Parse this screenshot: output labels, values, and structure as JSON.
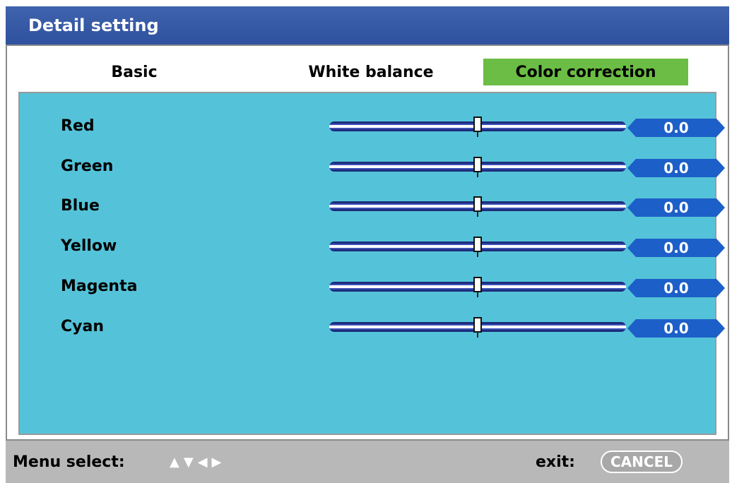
{
  "window": {
    "title": "Detail setting"
  },
  "tabs": [
    {
      "label": "Basic",
      "active": false
    },
    {
      "label": "White balance",
      "active": false
    },
    {
      "label": "Color correction",
      "active": true
    }
  ],
  "settings": [
    {
      "label": "Red",
      "value": "0.0",
      "fraction": 0.5
    },
    {
      "label": "Green",
      "value": "0.0",
      "fraction": 0.5
    },
    {
      "label": "Blue",
      "value": "0.0",
      "fraction": 0.5
    },
    {
      "label": "Yellow",
      "value": "0.0",
      "fraction": 0.5
    },
    {
      "label": "Magenta",
      "value": "0.0",
      "fraction": 0.5
    },
    {
      "label": "Cyan",
      "value": "0.0",
      "fraction": 0.5
    }
  ],
  "footer": {
    "menu_label": "Menu select:",
    "arrows": [
      "up-arrow-icon",
      "down-arrow-icon",
      "left-arrow-icon",
      "right-arrow-icon"
    ],
    "exit_label": "exit:",
    "cancel_label": "CANCEL"
  },
  "colors": {
    "title_bg": "#3f63ad",
    "active_tab": "#6bbd45",
    "panel_bg": "#54c3d9",
    "value_bg": "#1d5fc8",
    "footer_bg": "#b8b8b8"
  }
}
